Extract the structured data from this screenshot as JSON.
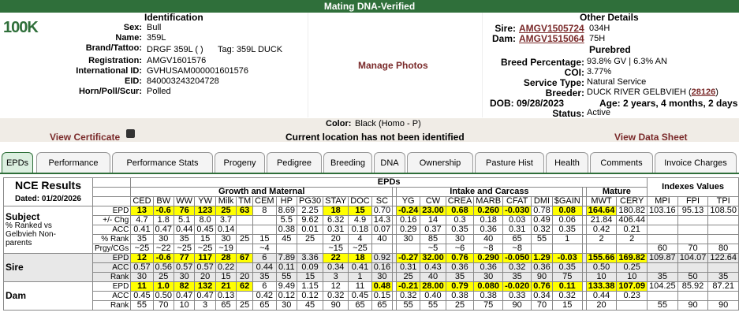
{
  "header": {
    "title": "Mating DNA-Verified"
  },
  "logo": {
    "text": "100K"
  },
  "identification": {
    "title": "Identification",
    "sex_label": "Sex:",
    "sex": "Bull",
    "name_label": "Name:",
    "name": "359L",
    "brand_label": "Brand/Tattoo:",
    "brand": "DRGF 359L ( )",
    "tag": "Tag: 359L DUCK",
    "registration_label": "Registration:",
    "registration": "AMGV1601576",
    "intl_label": "International ID:",
    "intl": "GVHUSAM000001601576",
    "eid_label": "EID:",
    "eid": "840003243204728",
    "horn_label": "Horn/Poll/Scur:",
    "horn": "Polled"
  },
  "photos": {
    "manage": "Manage Photos"
  },
  "other": {
    "title": "Other Details",
    "sire_label": "Sire:",
    "sire_id": "AMGV1505724",
    "sire_tag": "034H",
    "dam_label": "Dam:",
    "dam_id": "AMGV1515064",
    "dam_tag": "75H",
    "breed": "Purebred",
    "pct_label": "Breed Percentage:",
    "pct": "93.8% GV | 6.3% AN",
    "coi_label": "COI:",
    "coi": "3.77%",
    "service_label": "Service Type:",
    "service": "Natural Service",
    "breeder_label": "Breeder:",
    "breeder": "DUCK RIVER GELBVIEH (",
    "breeder_id": "28126",
    "breeder_end": ")",
    "dob": "DOB: 09/28/2023",
    "age": "Age: 2 years, 4 months, 2 days",
    "status_label": "Status:",
    "status": "Active"
  },
  "color": {
    "label": "Color:",
    "value": "Black (Homo - P)"
  },
  "strip": {
    "certificate": "View Certificate",
    "location": "Current location has not been identified",
    "datasheet": "View Data Sheet"
  },
  "tabs": [
    "EPDs",
    "Performance",
    "Performance Stats",
    "Progeny",
    "Pedigree",
    "Breeding",
    "DNA",
    "Ownership",
    "Pasture Hist",
    "Health",
    "Comments",
    "Invoice Charges"
  ],
  "epd": {
    "nce": "NCE Results",
    "dated": "Dated: 01/20/2026",
    "epds_title": "EPDs",
    "indexes_title": "Indexes Values",
    "growth": "Growth and Maternal",
    "intake": "Intake and Carcass",
    "mature": "Mature",
    "cols_growth": [
      "CED",
      "BW",
      "WW",
      "YW",
      "Milk",
      "TM",
      "CEM",
      "HP",
      "PG30",
      "STAY",
      "DOC",
      "SC"
    ],
    "cols_intake": [
      "YG",
      "CW",
      "CREA",
      "MARB",
      "CFAT",
      "DMI",
      "$GAIN"
    ],
    "cols_mature": [
      "MWT",
      "CERY"
    ],
    "cols_index": [
      "MPI",
      "FPI",
      "TPI"
    ],
    "subject": {
      "label": "Subject",
      "note": "% Ranked vs Gelbvieh Non-parents",
      "sub": [
        "EPD",
        "+/- Chg",
        "ACC",
        "% Rank",
        "Prgy/CGs"
      ],
      "epd": [
        "13",
        "-0.6",
        "76",
        "123",
        "25",
        "63",
        "8",
        "8.69",
        "2.25",
        "18",
        "15",
        "0.70",
        "-0.24",
        "23.00",
        "0.68",
        "0.260",
        "-0.030",
        "0.78",
        "0.08",
        "164.64",
        "180.82"
      ],
      "chg": [
        "4.7",
        "1.8",
        "5.1",
        "8.0",
        "3.7",
        "",
        "",
        "5.5",
        "9.62",
        "6.32",
        "4.9",
        "14.3",
        "0.16",
        "14",
        "0.3",
        "0.18",
        "0.03",
        "0.49",
        "0.06",
        "21.84",
        "406.44"
      ],
      "acc": [
        "0.41",
        "0.47",
        "0.44",
        "0.45",
        "0.14",
        "",
        "",
        "0.38",
        "0.01",
        "0.31",
        "0.18",
        "0.07",
        "0.29",
        "0.37",
        "0.35",
        "0.36",
        "0.31",
        "0.32",
        "0.35",
        "0.42",
        "0.21"
      ],
      "rank": [
        "35",
        "30",
        "35",
        "15",
        "30",
        "25",
        "15",
        "45",
        "25",
        "20",
        "4",
        "40",
        "30",
        "85",
        "30",
        "40",
        "65",
        "55",
        "1",
        "2",
        "2"
      ],
      "prgy": [
        "~25",
        "~22",
        "~25",
        "~25",
        "~19",
        "",
        "~4",
        "",
        "",
        "~15",
        "~25",
        "",
        "",
        "~5",
        "~6",
        "~8",
        "~8",
        "",
        "",
        "",
        ""
      ],
      "hl": [
        0,
        1,
        2,
        3,
        4,
        5,
        9,
        10,
        12,
        13,
        14,
        15,
        16,
        18,
        19
      ],
      "index": [
        "103.16",
        "95.13",
        "108.50"
      ],
      "index_rank": [
        "60",
        "70",
        "80"
      ]
    },
    "sire": {
      "label": "Sire",
      "sub": [
        "EPD",
        "ACC",
        "Rank"
      ],
      "epd": [
        "12",
        "-0.6",
        "77",
        "117",
        "28",
        "67",
        "6",
        "7.89",
        "3.36",
        "22",
        "18",
        "0.92",
        "-0.27",
        "32.00",
        "0.76",
        "0.290",
        "-0.050",
        "1.29",
        "-0.03",
        "155.66",
        "169.82"
      ],
      "acc": [
        "0.57",
        "0.56",
        "0.57",
        "0.57",
        "0.22",
        "",
        "0.44",
        "0.11",
        "0.09",
        "0.34",
        "0.41",
        "0.16",
        "0.31",
        "0.43",
        "0.36",
        "0.36",
        "0.32",
        "0.36",
        "0.35",
        "0.50",
        "0.25"
      ],
      "rank": [
        "30",
        "25",
        "30",
        "20",
        "15",
        "20",
        "35",
        "55",
        "15",
        "3",
        "1",
        "30",
        "25",
        "40",
        "35",
        "30",
        "35",
        "90",
        "75",
        "10",
        "10"
      ],
      "hl": [
        0,
        1,
        2,
        3,
        4,
        5,
        9,
        10,
        12,
        13,
        14,
        15,
        16,
        17,
        18,
        19,
        20
      ],
      "index": [
        "109.87",
        "104.07",
        "122.64"
      ],
      "index_rank": [
        "35",
        "50",
        "35"
      ]
    },
    "dam": {
      "label": "Dam",
      "sub": [
        "EPD",
        "ACC",
        "Rank"
      ],
      "epd": [
        "11",
        "1.0",
        "82",
        "132",
        "21",
        "62",
        "6",
        "9.49",
        "1.15",
        "12",
        "11",
        "0.48",
        "-0.21",
        "28.00",
        "0.79",
        "0.080",
        "-0.020",
        "0.76",
        "0.11",
        "133.38",
        "107.09"
      ],
      "acc": [
        "0.45",
        "0.50",
        "0.47",
        "0.47",
        "0.13",
        "",
        "0.42",
        "0.12",
        "0.12",
        "0.32",
        "0.45",
        "0.15",
        "0.32",
        "0.40",
        "0.38",
        "0.38",
        "0.33",
        "0.34",
        "0.32",
        "0.44",
        "0.23"
      ],
      "rank": [
        "55",
        "70",
        "10",
        "3",
        "65",
        "25",
        "65",
        "30",
        "45",
        "90",
        "65",
        "65",
        "55",
        "55",
        "25",
        "75",
        "90",
        "70",
        "15",
        "20"
      ],
      "hl": [
        0,
        1,
        2,
        3,
        4,
        5,
        11,
        12,
        13,
        14,
        15,
        16,
        17,
        18,
        19,
        20
      ],
      "index": [
        "104.25",
        "85.92",
        "87.21"
      ],
      "index_rank": [
        "55",
        "90",
        "90"
      ]
    }
  }
}
